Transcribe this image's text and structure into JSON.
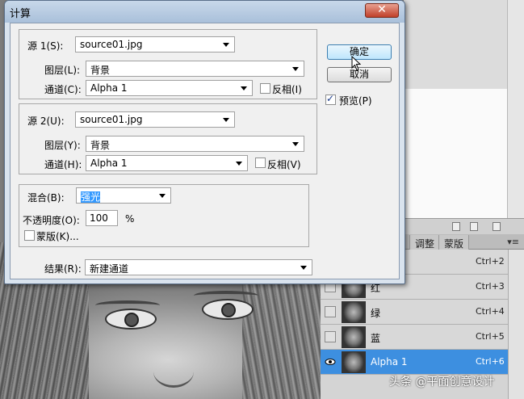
{
  "dialog": {
    "title": "计算",
    "close_label": "✕",
    "source1": {
      "group_label": "源 1(S):",
      "file": "source01.jpg",
      "layer_label": "图层(L):",
      "layer_value": "背景",
      "channel_label": "通道(C):",
      "channel_value": "Alpha 1",
      "invert_label": "反相(I)",
      "invert_checked": false
    },
    "source2": {
      "group_label": "源 2(U):",
      "file": "source01.jpg",
      "layer_label": "图层(Y):",
      "layer_value": "背景",
      "channel_label": "通道(H):",
      "channel_value": "Alpha 1",
      "invert_label": "反相(V)",
      "invert_checked": false
    },
    "blending": {
      "blend_label": "混合(B):",
      "blend_value": "强光",
      "opacity_label": "不透明度(O):",
      "opacity_value": "100",
      "opacity_unit": "%",
      "mask_label": "蒙版(K)...",
      "mask_checked": false
    },
    "result": {
      "label": "结果(R):",
      "value": "新建通道"
    },
    "ok_label": "确定",
    "cancel_label": "取消",
    "preview_label": "预览(P)",
    "preview_checked": true
  },
  "channels_panel": {
    "tabs": [
      "调整",
      "蒙版"
    ],
    "menu_icon": "▾≡",
    "rows": [
      {
        "name": "",
        "shortcut": "Ctrl+2",
        "visible": false,
        "selected": false
      },
      {
        "name": "红",
        "shortcut": "Ctrl+3",
        "visible": false,
        "selected": false
      },
      {
        "name": "绿",
        "shortcut": "Ctrl+4",
        "visible": false,
        "selected": false
      },
      {
        "name": "蓝",
        "shortcut": "Ctrl+5",
        "visible": false,
        "selected": false
      },
      {
        "name": "Alpha 1",
        "shortcut": "Ctrl+6",
        "visible": true,
        "selected": true
      }
    ]
  },
  "watermark": "头条 @平面创意设计",
  "colors": {
    "selection": "#3d8fe0",
    "dialog_bg": "#f0f0f0",
    "title_bg": "#a9c0da",
    "close_red": "#c0402a"
  }
}
